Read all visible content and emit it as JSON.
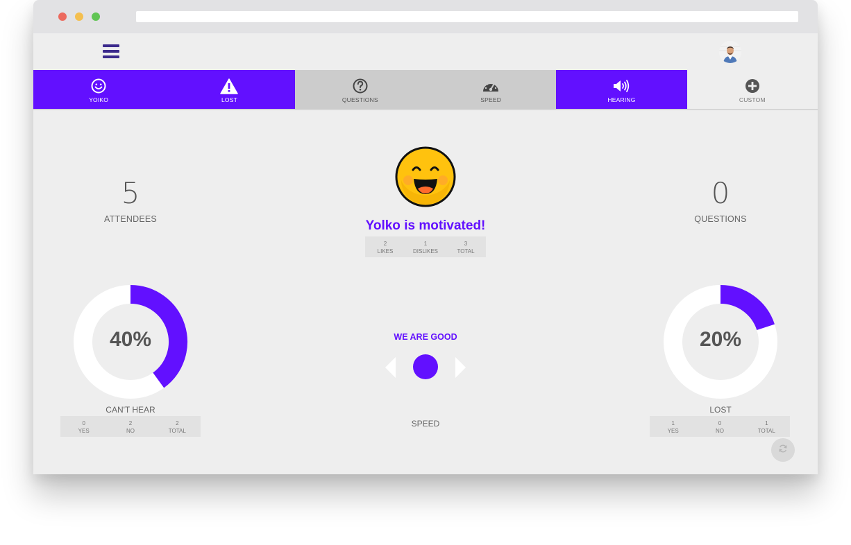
{
  "window": {
    "dots": {
      "red": "#ec6a5e",
      "yellow": "#f4bf4f",
      "green": "#61c554"
    }
  },
  "header": {
    "menu_icon": "hamburger-menu-icon",
    "avatar_icon": "user-avatar"
  },
  "tabs": [
    {
      "label": "YOIKO",
      "icon": "smiley-icon",
      "state": "active"
    },
    {
      "label": "LOST",
      "icon": "warning-icon",
      "state": "active"
    },
    {
      "label": "QUESTIONS",
      "icon": "question-circle-icon",
      "state": "inactive"
    },
    {
      "label": "SPEED",
      "icon": "speedometer-icon",
      "state": "inactive"
    },
    {
      "label": "HEARING",
      "icon": "volume-icon",
      "state": "active"
    },
    {
      "label": "CUSTOM",
      "icon": "plus-circle-icon",
      "state": "neutral"
    }
  ],
  "attendees": {
    "value": "5",
    "label": "ATTENDEES"
  },
  "questions": {
    "value": "0",
    "label": "QUESTIONS"
  },
  "mood": {
    "icon": "laughing-face-icon",
    "title": "Yolko is motivated!",
    "stats": [
      {
        "value": "2",
        "label": "LIKES"
      },
      {
        "value": "1",
        "label": "DISLIKES"
      },
      {
        "value": "3",
        "label": "TOTAL"
      }
    ]
  },
  "cant_hear": {
    "percent_label": "40%",
    "percent": 40,
    "caption": "CAN'T HEAR",
    "stats": [
      {
        "value": "0",
        "label": "YES"
      },
      {
        "value": "2",
        "label": "NO"
      },
      {
        "value": "2",
        "label": "TOTAL"
      }
    ]
  },
  "lost": {
    "percent_label": "20%",
    "percent": 20,
    "caption": "LOST",
    "stats": [
      {
        "value": "1",
        "label": "YES"
      },
      {
        "value": "0",
        "label": "NO"
      },
      {
        "value": "1",
        "label": "TOTAL"
      }
    ]
  },
  "speed": {
    "status": "WE ARE GOOD",
    "caption": "SPEED"
  },
  "refresh_icon": "refresh-icon",
  "colors": {
    "accent": "#6210ff",
    "inactive_tab": "#cccccc",
    "background": "#eeeeee",
    "donut_track": "#ffffff"
  }
}
